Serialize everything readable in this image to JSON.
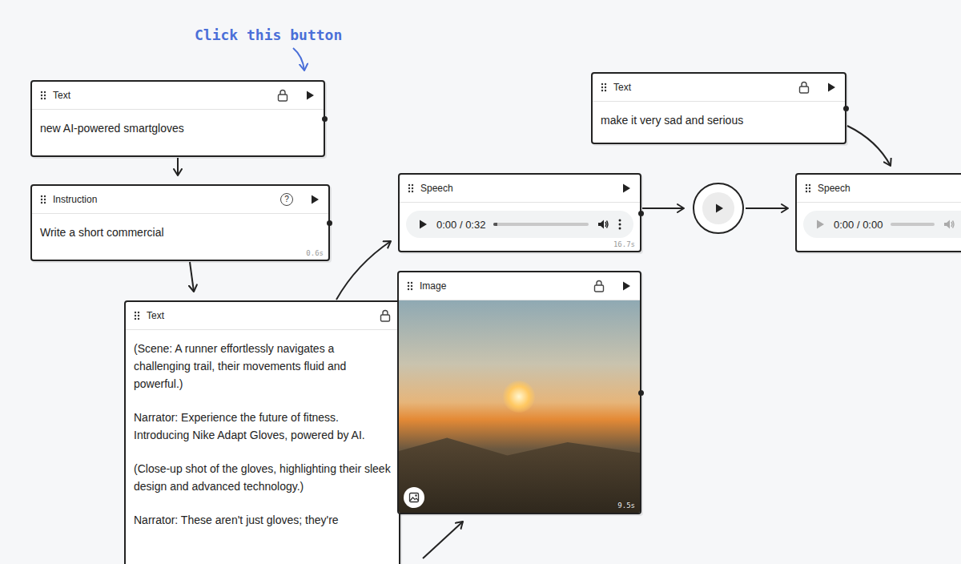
{
  "annotation": {
    "text": "Click this button"
  },
  "nodes": [
    {
      "kind": "text",
      "title": "Text",
      "lockable": true,
      "runnable": true,
      "paragraphs": [
        "new AI-powered smartgloves"
      ]
    },
    {
      "kind": "instruction",
      "title": "Instruction",
      "help": "?",
      "runnable": true,
      "paragraphs": [
        "Write a short commercial"
      ],
      "duration": "0.6s"
    },
    {
      "kind": "text",
      "title": "Text",
      "lockable": true,
      "runnable": false,
      "paragraphs": [
        "(Scene: A runner effortlessly navigates a challenging trail, their movements fluid and powerful.)",
        "Narrator: Experience the future of fitness. Introducing Nike Adapt Gloves, powered by AI.",
        "(Close-up shot of the gloves, highlighting their sleek design and advanced technology.)",
        "Narrator: These aren't just gloves; they're"
      ]
    },
    {
      "kind": "speech",
      "title": "Speech",
      "runnable": true,
      "player": {
        "time": "0:00 / 0:32",
        "level": 0.04,
        "disabled": false
      },
      "duration": "16.7s"
    },
    {
      "kind": "run",
      "runnable": true
    },
    {
      "kind": "text",
      "title": "Text",
      "lockable": true,
      "runnable": true,
      "paragraphs": [
        "make it very sad and serious"
      ]
    },
    {
      "kind": "speech",
      "title": "Speech",
      "runnable": false,
      "player": {
        "time": "0:00 / 0:00",
        "level": 0,
        "disabled": true
      }
    },
    {
      "kind": "image",
      "title": "Image",
      "lockable": true,
      "runnable": true,
      "duration": "9.5s"
    }
  ]
}
